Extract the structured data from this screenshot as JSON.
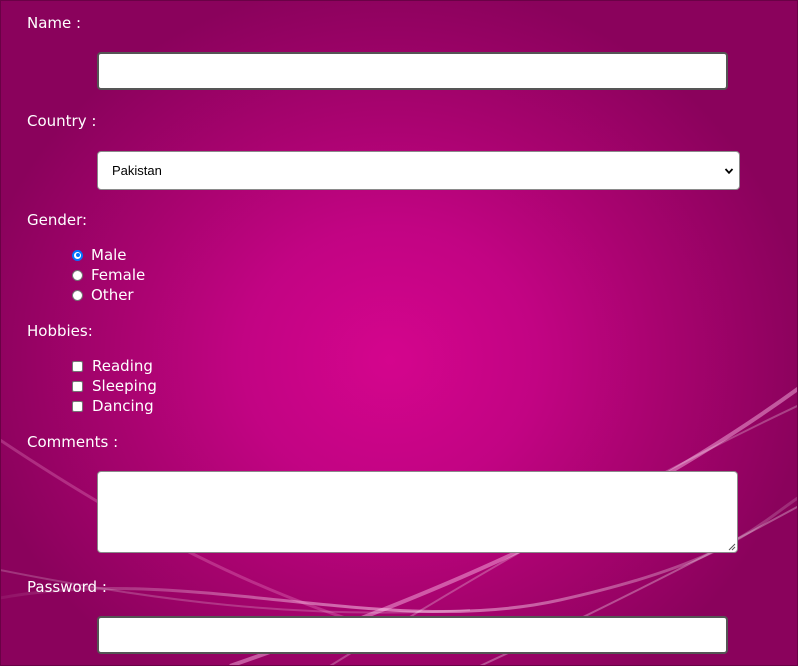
{
  "form": {
    "name": {
      "label": "Name :",
      "value": ""
    },
    "country": {
      "label": "Country :",
      "selected": "Pakistan"
    },
    "gender": {
      "label": "Gender:",
      "options": [
        {
          "label": "Male",
          "checked": true
        },
        {
          "label": "Female",
          "checked": false
        },
        {
          "label": "Other",
          "checked": false
        }
      ]
    },
    "hobbies": {
      "label": "Hobbies:",
      "options": [
        {
          "label": "Reading",
          "checked": false
        },
        {
          "label": "Sleeping",
          "checked": false
        },
        {
          "label": "Dancing",
          "checked": false
        }
      ]
    },
    "comments": {
      "label": "Comments :",
      "value": ""
    },
    "password": {
      "label": "Password :",
      "value": ""
    }
  },
  "colors": {
    "background": "#c20483",
    "text": "#ffffff",
    "radio_accent": "#0075ff"
  },
  "icons": {
    "select_arrow": "chevron-down-icon",
    "textarea_grip": "resize-grip-icon"
  }
}
